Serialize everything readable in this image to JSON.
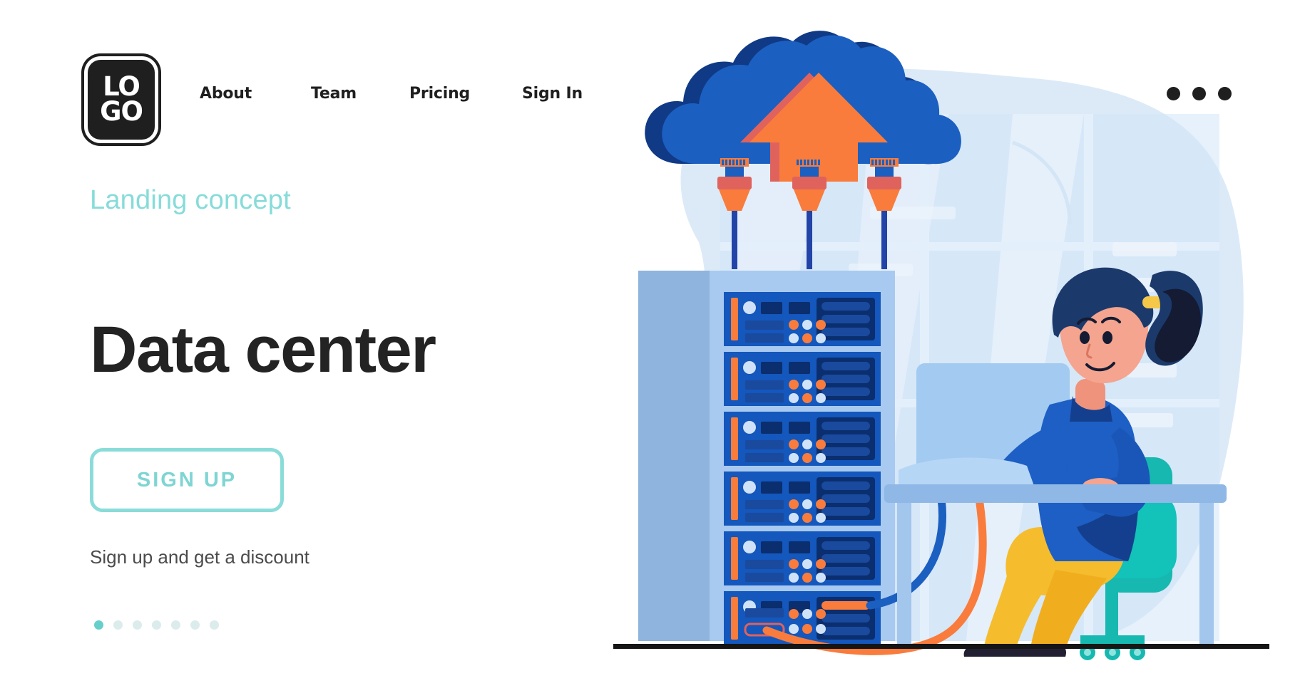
{
  "header": {
    "logo": {
      "line1": "LO",
      "line2": "GO",
      "name": "LOGO"
    },
    "nav": [
      {
        "label": "About"
      },
      {
        "label": "Team"
      },
      {
        "label": "Pricing"
      },
      {
        "label": "Sign In"
      }
    ],
    "menu_icon": "kebab-menu-icon"
  },
  "hero": {
    "eyebrow": "Landing concept",
    "headline": "Data center",
    "cta_label": "SIGN UP",
    "subnote": "Sign up and get a discount",
    "pagination": {
      "total": 7,
      "active_index": 0
    }
  },
  "illustration": {
    "alt": "Data center illustration: cloud upload, server rack, woman at desk with computer",
    "cloud": {
      "label": "cloud-upload"
    },
    "rack": {
      "units": 6
    },
    "person": {
      "label": "woman-working-at-desk"
    }
  },
  "colors": {
    "accent_teal": "#7ed5d3",
    "eyebrow_teal": "#86dcd9",
    "text_dark": "#232323",
    "text_muted": "#4b4b4b",
    "cloud_blue": "#1b5fc1",
    "cloud_blue_dark": "#103a85",
    "orange": "#f97c3c",
    "orange_dark": "#e0625c",
    "rack_body": "#a9c6e8",
    "rack_face": "#9ec0ea",
    "server_blue": "#1457bd",
    "server_navy": "#0b2e6e",
    "chair_teal": "#17b8b0",
    "pants_yellow": "#f5bc2e",
    "shirt_blue": "#1d5fc4",
    "skin": "#f4a48f",
    "hair_navy": "#1b3a6b",
    "bg_blob": "#dceaf8",
    "floor_line": "#151515"
  }
}
